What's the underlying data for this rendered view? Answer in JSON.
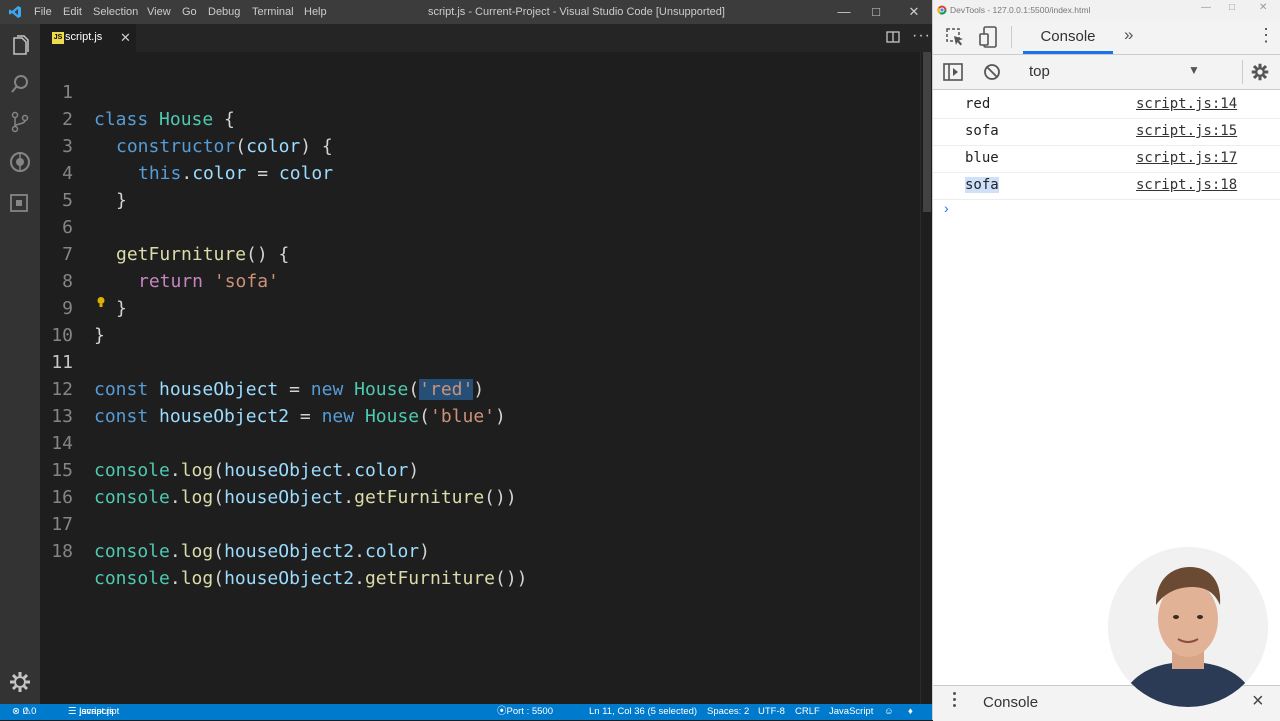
{
  "window": {
    "title": "script.js - Current-Project - Visual Studio Code [Unsupported]",
    "menu": [
      "File",
      "Edit",
      "Selection",
      "View",
      "Go",
      "Debug",
      "Terminal",
      "Help"
    ]
  },
  "tab": {
    "label": "script.js",
    "icon": "js-file-icon"
  },
  "editor": {
    "active_line": 11,
    "lines": [
      {
        "n": "1"
      },
      {
        "n": "2"
      },
      {
        "n": "3"
      },
      {
        "n": "4"
      },
      {
        "n": "5"
      },
      {
        "n": "6"
      },
      {
        "n": "7"
      },
      {
        "n": "8"
      },
      {
        "n": "9"
      },
      {
        "n": "10"
      },
      {
        "n": "11"
      },
      {
        "n": "12"
      },
      {
        "n": "13"
      },
      {
        "n": "14"
      },
      {
        "n": "15"
      },
      {
        "n": "16"
      },
      {
        "n": "17"
      },
      {
        "n": "18"
      }
    ],
    "code": {
      "l1": [
        "class",
        " ",
        "House",
        " {"
      ],
      "l2": [
        "constructor",
        "(",
        "color",
        ") {"
      ],
      "l3": [
        "this",
        ".",
        "color",
        " = ",
        "color"
      ],
      "l4": [
        "}"
      ],
      "l6": [
        "getFurniture",
        "() {"
      ],
      "l7": [
        "return",
        " ",
        "'sofa'"
      ],
      "l8": [
        "}"
      ],
      "l9": [
        "}"
      ],
      "l11": [
        "const",
        " ",
        "houseObject",
        " = ",
        "new",
        " ",
        "House",
        "(",
        "'red'",
        ")"
      ],
      "l12": [
        "const",
        " ",
        "houseObject2",
        " = ",
        "new",
        " ",
        "House",
        "(",
        "'blue'",
        ")"
      ],
      "l14": [
        "console",
        ".",
        "log",
        "(",
        "houseObject",
        ".",
        "color",
        ")"
      ],
      "l15": [
        "console",
        ".",
        "log",
        "(",
        "houseObject",
        ".",
        "getFurniture",
        "())"
      ],
      "l17": [
        "console",
        ".",
        "log",
        "(",
        "houseObject2",
        ".",
        "color",
        ")"
      ],
      "l18": [
        "console",
        ".",
        "log",
        "(",
        "houseObject2",
        ".",
        "getFurniture",
        "())"
      ]
    }
  },
  "statusbar": {
    "errors": "0",
    "warnings": "0",
    "language_ctx": "javascript",
    "file": "script.js",
    "port": "Port : 5500",
    "cursor": "Ln 11, Col 36 (5 selected)",
    "spaces": "Spaces: 2",
    "encoding": "UTF-8",
    "eol": "CRLF",
    "language": "JavaScript"
  },
  "devtools": {
    "window_title": "DevTools - 127.0.0.1:5500/index.html",
    "active_tab": "Console",
    "more_tabs": "»",
    "context": "top",
    "logs": [
      {
        "msg": "red",
        "src": "script.js:14"
      },
      {
        "msg": "sofa",
        "src": "script.js:15"
      },
      {
        "msg": "blue",
        "src": "script.js:17"
      },
      {
        "msg": "sofa",
        "src": "script.js:18"
      }
    ],
    "prompt": "›",
    "drawer_label": "Console",
    "drawer_close": "×"
  },
  "colors": {
    "keyword": "#569cd6",
    "class": "#4ec9b0",
    "function": "#dcdcaa",
    "variable": "#9cdcfe",
    "string": "#ce9178",
    "statusbar": "#007acc",
    "devtools_accent": "#1a73e8"
  }
}
